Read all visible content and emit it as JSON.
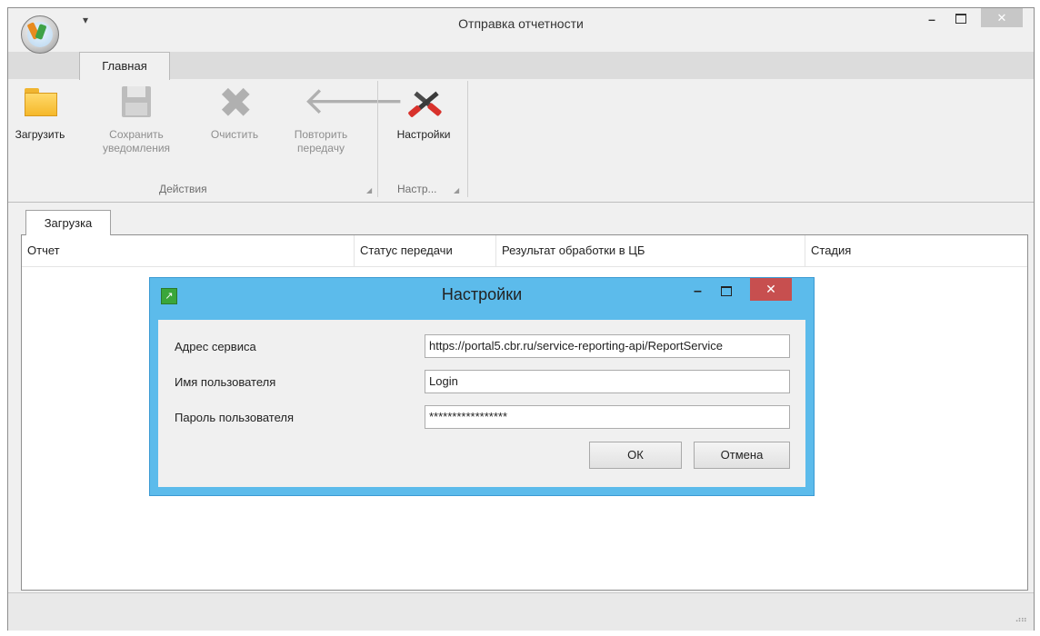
{
  "window": {
    "title": "Отправка отчетности",
    "qat_symbol": "▾",
    "controls": {
      "minimize": "–",
      "close": "✕"
    }
  },
  "ribbon": {
    "tab": "Главная",
    "groups": [
      {
        "label": "Действия",
        "launcher": "◢"
      },
      {
        "label": "Настр...",
        "launcher": "◢"
      }
    ],
    "buttons": {
      "load": {
        "label": "Загрузить",
        "icon": "folder-icon"
      },
      "save_notifications": {
        "line1": "Сохранить",
        "line2": "уведомления",
        "icon": "save-icon"
      },
      "clear": {
        "label": "Очистить",
        "icon": "clear-icon"
      },
      "retry": {
        "line1": "Повторить",
        "line2": "передачу",
        "icon": "back-arrow-icon"
      },
      "settings": {
        "label": "Настройки",
        "icon": "tools-icon"
      }
    }
  },
  "doc_tab": "Загрузка",
  "grid": {
    "columns": [
      "Отчет",
      "Статус передачи",
      "Результат обработки в ЦБ",
      "Стадия"
    ],
    "rows": []
  },
  "status_grip": "⠴⠶",
  "dialog": {
    "title": "Настройки",
    "icon": "↗",
    "controls": {
      "minimize": "–",
      "close": "✕"
    },
    "fields": {
      "service_address": {
        "label": "Адрес сервиса",
        "value": "https://portal5.cbr.ru/service-reporting-api/ReportService"
      },
      "username": {
        "label": "Имя пользователя",
        "value": "Login"
      },
      "password": {
        "label": "Пароль пользователя",
        "value": "*****************"
      }
    },
    "ok": "ОК",
    "cancel": "Отмена"
  },
  "colors": {
    "dialog_frame": "#5cbbeb",
    "dialog_close": "#c74f4f",
    "window_bg": "#f0f0f0"
  }
}
